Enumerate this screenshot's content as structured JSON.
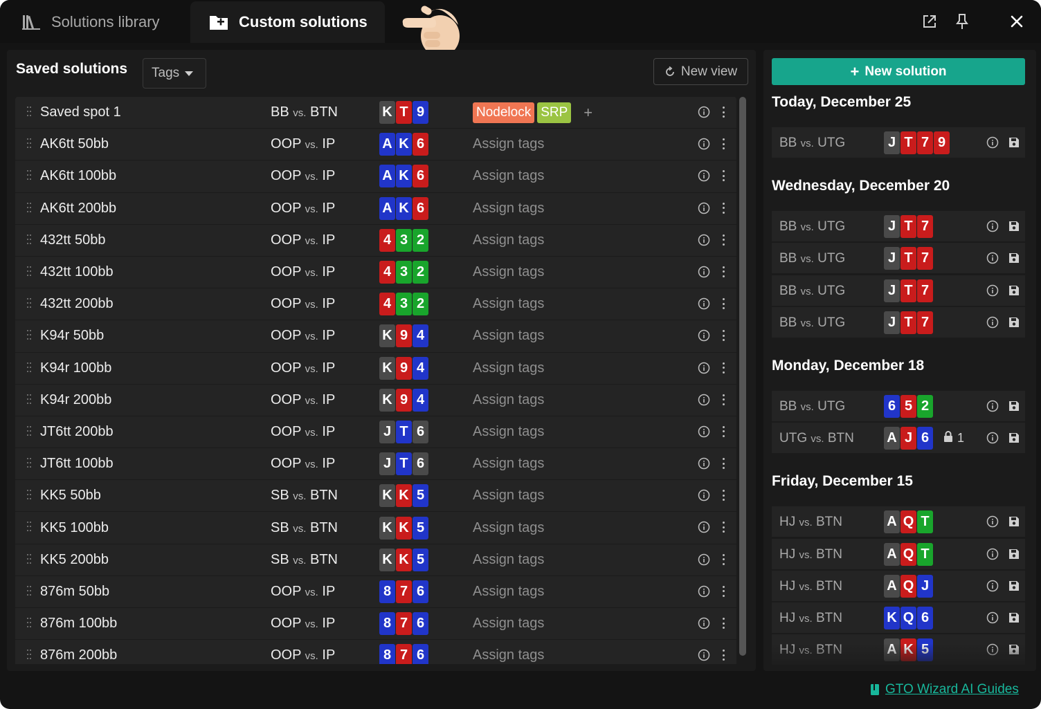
{
  "tabs": [
    {
      "label": "Solutions library",
      "icon": "library-icon"
    },
    {
      "label": "Custom solutions",
      "icon": "folder-plus-icon"
    }
  ],
  "header": {
    "title": "Saved solutions",
    "tags_label": "Tags",
    "new_view_label": "New view"
  },
  "colors": {
    "spade": "#4a4a4a",
    "heart": "#c91c1c",
    "diamond": "#2135c9",
    "club": "#19a52c",
    "accent": "#17a58c",
    "nodelock": "#f07653",
    "srp": "#9bc443"
  },
  "solutions": [
    {
      "name": "Saved spot 1",
      "p1": "BB",
      "vs": "vs.",
      "p2": "BTN",
      "cards": [
        {
          "r": "K",
          "s": "s"
        },
        {
          "r": "T",
          "s": "h"
        },
        {
          "r": "9",
          "s": "d"
        }
      ],
      "tags": [
        {
          "label": "Nodelock",
          "color": "#f07653"
        },
        {
          "label": "SRP",
          "color": "#9bc443"
        }
      ],
      "add_tag": "+"
    },
    {
      "name": "AK6tt 50bb",
      "p1": "OOP",
      "vs": "vs.",
      "p2": "IP",
      "cards": [
        {
          "r": "A",
          "s": "d"
        },
        {
          "r": "K",
          "s": "d"
        },
        {
          "r": "6",
          "s": "h"
        }
      ],
      "assign": "Assign tags"
    },
    {
      "name": "AK6tt 100bb",
      "p1": "OOP",
      "vs": "vs.",
      "p2": "IP",
      "cards": [
        {
          "r": "A",
          "s": "d"
        },
        {
          "r": "K",
          "s": "d"
        },
        {
          "r": "6",
          "s": "h"
        }
      ],
      "assign": "Assign tags"
    },
    {
      "name": "AK6tt 200bb",
      "p1": "OOP",
      "vs": "vs.",
      "p2": "IP",
      "cards": [
        {
          "r": "A",
          "s": "d"
        },
        {
          "r": "K",
          "s": "d"
        },
        {
          "r": "6",
          "s": "h"
        }
      ],
      "assign": "Assign tags"
    },
    {
      "name": "432tt 50bb",
      "p1": "OOP",
      "vs": "vs.",
      "p2": "IP",
      "cards": [
        {
          "r": "4",
          "s": "h"
        },
        {
          "r": "3",
          "s": "c"
        },
        {
          "r": "2",
          "s": "c"
        }
      ],
      "assign": "Assign tags"
    },
    {
      "name": "432tt 100bb",
      "p1": "OOP",
      "vs": "vs.",
      "p2": "IP",
      "cards": [
        {
          "r": "4",
          "s": "h"
        },
        {
          "r": "3",
          "s": "c"
        },
        {
          "r": "2",
          "s": "c"
        }
      ],
      "assign": "Assign tags"
    },
    {
      "name": "432tt 200bb",
      "p1": "OOP",
      "vs": "vs.",
      "p2": "IP",
      "cards": [
        {
          "r": "4",
          "s": "h"
        },
        {
          "r": "3",
          "s": "c"
        },
        {
          "r": "2",
          "s": "c"
        }
      ],
      "assign": "Assign tags"
    },
    {
      "name": "K94r 50bb",
      "p1": "OOP",
      "vs": "vs.",
      "p2": "IP",
      "cards": [
        {
          "r": "K",
          "s": "s"
        },
        {
          "r": "9",
          "s": "h"
        },
        {
          "r": "4",
          "s": "d"
        }
      ],
      "assign": "Assign tags"
    },
    {
      "name": "K94r 100bb",
      "p1": "OOP",
      "vs": "vs.",
      "p2": "IP",
      "cards": [
        {
          "r": "K",
          "s": "s"
        },
        {
          "r": "9",
          "s": "h"
        },
        {
          "r": "4",
          "s": "d"
        }
      ],
      "assign": "Assign tags"
    },
    {
      "name": "K94r 200bb",
      "p1": "OOP",
      "vs": "vs.",
      "p2": "IP",
      "cards": [
        {
          "r": "K",
          "s": "s"
        },
        {
          "r": "9",
          "s": "h"
        },
        {
          "r": "4",
          "s": "d"
        }
      ],
      "assign": "Assign tags"
    },
    {
      "name": "JT6tt 200bb",
      "p1": "OOP",
      "vs": "vs.",
      "p2": "IP",
      "cards": [
        {
          "r": "J",
          "s": "s"
        },
        {
          "r": "T",
          "s": "d"
        },
        {
          "r": "6",
          "s": "s"
        }
      ],
      "assign": "Assign tags"
    },
    {
      "name": "JT6tt 100bb",
      "p1": "OOP",
      "vs": "vs.",
      "p2": "IP",
      "cards": [
        {
          "r": "J",
          "s": "s"
        },
        {
          "r": "T",
          "s": "d"
        },
        {
          "r": "6",
          "s": "s"
        }
      ],
      "assign": "Assign tags"
    },
    {
      "name": "KK5 50bb",
      "p1": "SB",
      "vs": "vs.",
      "p2": "BTN",
      "cards": [
        {
          "r": "K",
          "s": "s"
        },
        {
          "r": "K",
          "s": "h"
        },
        {
          "r": "5",
          "s": "d"
        }
      ],
      "assign": "Assign tags"
    },
    {
      "name": "KK5 100bb",
      "p1": "SB",
      "vs": "vs.",
      "p2": "BTN",
      "cards": [
        {
          "r": "K",
          "s": "s"
        },
        {
          "r": "K",
          "s": "h"
        },
        {
          "r": "5",
          "s": "d"
        }
      ],
      "assign": "Assign tags"
    },
    {
      "name": "KK5 200bb",
      "p1": "SB",
      "vs": "vs.",
      "p2": "BTN",
      "cards": [
        {
          "r": "K",
          "s": "s"
        },
        {
          "r": "K",
          "s": "h"
        },
        {
          "r": "5",
          "s": "d"
        }
      ],
      "assign": "Assign tags"
    },
    {
      "name": "876m 50bb",
      "p1": "OOP",
      "vs": "vs.",
      "p2": "IP",
      "cards": [
        {
          "r": "8",
          "s": "d"
        },
        {
          "r": "7",
          "s": "h"
        },
        {
          "r": "6",
          "s": "d"
        }
      ],
      "assign": "Assign tags"
    },
    {
      "name": "876m 100bb",
      "p1": "OOP",
      "vs": "vs.",
      "p2": "IP",
      "cards": [
        {
          "r": "8",
          "s": "d"
        },
        {
          "r": "7",
          "s": "h"
        },
        {
          "r": "6",
          "s": "d"
        }
      ],
      "assign": "Assign tags"
    },
    {
      "name": "876m 200bb",
      "p1": "OOP",
      "vs": "vs.",
      "p2": "IP",
      "cards": [
        {
          "r": "8",
          "s": "d"
        },
        {
          "r": "7",
          "s": "h"
        },
        {
          "r": "6",
          "s": "d"
        }
      ],
      "assign": "Assign tags"
    }
  ],
  "recent": {
    "new_solution_label": "New solution",
    "days": [
      {
        "title": "Today, December 25",
        "items": [
          {
            "p1": "BB",
            "vs": "vs.",
            "p2": "UTG",
            "cards": [
              {
                "r": "J",
                "s": "s"
              },
              {
                "r": "T",
                "s": "h"
              },
              {
                "r": "7",
                "s": "h"
              },
              {
                "r": "9",
                "s": "h"
              }
            ]
          }
        ]
      },
      {
        "title": "Wednesday, December 20",
        "items": [
          {
            "p1": "BB",
            "vs": "vs.",
            "p2": "UTG",
            "cards": [
              {
                "r": "J",
                "s": "s"
              },
              {
                "r": "T",
                "s": "h"
              },
              {
                "r": "7",
                "s": "h"
              }
            ]
          },
          {
            "p1": "BB",
            "vs": "vs.",
            "p2": "UTG",
            "cards": [
              {
                "r": "J",
                "s": "s"
              },
              {
                "r": "T",
                "s": "h"
              },
              {
                "r": "7",
                "s": "h"
              }
            ]
          },
          {
            "p1": "BB",
            "vs": "vs.",
            "p2": "UTG",
            "cards": [
              {
                "r": "J",
                "s": "s"
              },
              {
                "r": "T",
                "s": "h"
              },
              {
                "r": "7",
                "s": "h"
              }
            ]
          },
          {
            "p1": "BB",
            "vs": "vs.",
            "p2": "UTG",
            "cards": [
              {
                "r": "J",
                "s": "s"
              },
              {
                "r": "T",
                "s": "h"
              },
              {
                "r": "7",
                "s": "h"
              }
            ]
          }
        ]
      },
      {
        "title": "Monday, December 18",
        "items": [
          {
            "p1": "BB",
            "vs": "vs.",
            "p2": "UTG",
            "cards": [
              {
                "r": "6",
                "s": "d"
              },
              {
                "r": "5",
                "s": "h"
              },
              {
                "r": "2",
                "s": "c"
              }
            ]
          },
          {
            "p1": "UTG",
            "vs": "vs.",
            "p2": "BTN",
            "cards": [
              {
                "r": "A",
                "s": "s"
              },
              {
                "r": "J",
                "s": "h"
              },
              {
                "r": "6",
                "s": "d"
              }
            ],
            "lock_count": "1"
          }
        ]
      },
      {
        "title": "Friday, December 15",
        "items": [
          {
            "p1": "HJ",
            "vs": "vs.",
            "p2": "BTN",
            "cards": [
              {
                "r": "A",
                "s": "s"
              },
              {
                "r": "Q",
                "s": "h"
              },
              {
                "r": "T",
                "s": "c"
              }
            ]
          },
          {
            "p1": "HJ",
            "vs": "vs.",
            "p2": "BTN",
            "cards": [
              {
                "r": "A",
                "s": "s"
              },
              {
                "r": "Q",
                "s": "h"
              },
              {
                "r": "T",
                "s": "c"
              }
            ]
          },
          {
            "p1": "HJ",
            "vs": "vs.",
            "p2": "BTN",
            "cards": [
              {
                "r": "A",
                "s": "s"
              },
              {
                "r": "Q",
                "s": "h"
              },
              {
                "r": "J",
                "s": "d"
              }
            ]
          },
          {
            "p1": "HJ",
            "vs": "vs.",
            "p2": "BTN",
            "cards": [
              {
                "r": "K",
                "s": "d"
              },
              {
                "r": "Q",
                "s": "d"
              },
              {
                "r": "6",
                "s": "d"
              }
            ]
          },
          {
            "p1": "HJ",
            "vs": "vs.",
            "p2": "BTN",
            "cards": [
              {
                "r": "A",
                "s": "s"
              },
              {
                "r": "K",
                "s": "h"
              },
              {
                "r": "5",
                "s": "d"
              }
            ]
          }
        ]
      }
    ]
  },
  "footer": {
    "guide_link": "GTO Wizard AI Guides",
    "icon": "book-icon"
  }
}
